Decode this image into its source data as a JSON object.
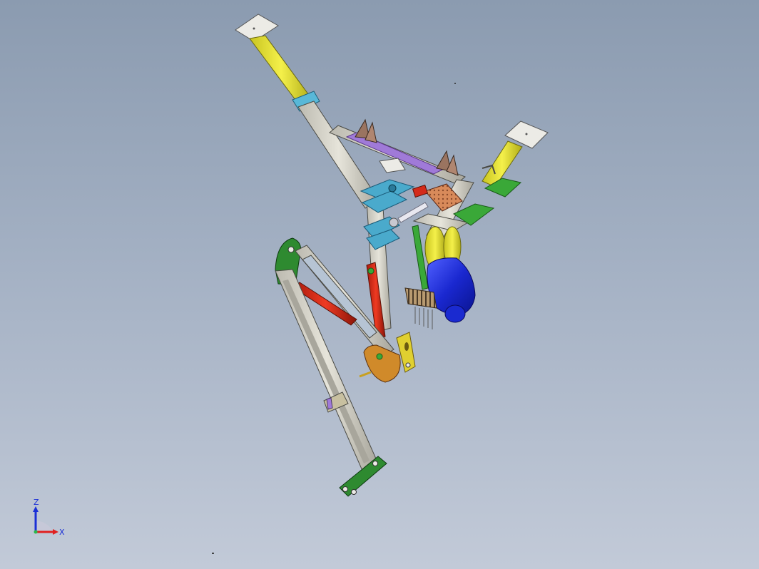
{
  "viewport": {
    "background_top": "#8b9bb0",
    "background_bottom": "#c2cad8"
  },
  "triad": {
    "z_label": "Z",
    "x_label": "X",
    "z_color": "#1a2fd6",
    "x_color": "#e02020"
  },
  "model": {
    "colors": {
      "frame": "#d8d6cc",
      "frame_edge": "#4a4a44",
      "post_yellow": "#e8e43a",
      "pad": "#ecebe6",
      "crossbar_purple": "#a07ad8",
      "clamp_cyan": "#4aaacc",
      "cylinder_red": "#d42a1a",
      "bracket_green": "#3aa838",
      "boom_green": "#2e8a30",
      "plate_orange": "#d08a2a",
      "plate_yellow": "#e0d030",
      "tank_blue": "#2236d8",
      "gear_copper": "#d88a5a",
      "rod_silver": "#e8e8f0"
    }
  }
}
